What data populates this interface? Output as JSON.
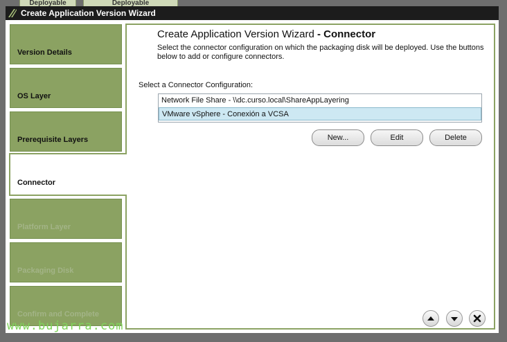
{
  "background_tabs": [
    {
      "label": "Deployable"
    },
    {
      "label": "Deployable"
    }
  ],
  "window": {
    "title": "Create Application Version Wizard",
    "logo_icon": "unidesk-logo-icon"
  },
  "nav": {
    "items": [
      {
        "label": "Version Details",
        "state": "enabled"
      },
      {
        "label": "OS Layer",
        "state": "enabled"
      },
      {
        "label": "Prerequisite Layers",
        "state": "enabled"
      },
      {
        "label": "Connector",
        "state": "active"
      },
      {
        "label": "Platform Layer",
        "state": "disabled"
      },
      {
        "label": "Packaging Disk",
        "state": "disabled"
      },
      {
        "label": "Confirm and Complete",
        "state": "disabled"
      }
    ]
  },
  "main": {
    "heading_prefix": "Create Application Version Wizard",
    "heading_suffix": "- Connector",
    "description": "Select the connector configuration on which the packaging disk will be deployed.  Use the buttons below to add or configure connectors.",
    "select_label": "Select a Connector Configuration:",
    "connectors": [
      {
        "label": "Network File Share - \\\\dc.curso.local\\ShareAppLayering",
        "selected": false
      },
      {
        "label": "VMware vSphere - Conexión a VCSA",
        "selected": true
      }
    ],
    "buttons": {
      "new": "New...",
      "edit": "Edit",
      "delete": "Delete"
    }
  },
  "footer": {
    "icons": [
      "arrow-up-icon",
      "arrow-down-icon",
      "close-icon"
    ]
  },
  "watermark": "www.bujarra.com",
  "colors": {
    "accent": "#8ba262",
    "titlebar": "#1c1c1c",
    "selection": "#cde8f3",
    "watermark": "#7fd45a"
  }
}
